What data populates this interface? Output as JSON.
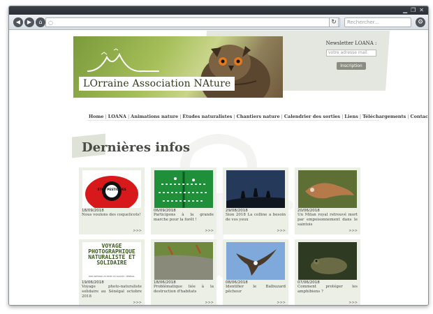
{
  "browser": {
    "search_placeholder": "Rechercher...",
    "nav_icons": [
      "back-icon",
      "forward-icon",
      "home-icon"
    ],
    "window_controls": [
      "minimize",
      "restore",
      "close"
    ]
  },
  "header": {
    "banner_title": "LOrraine Association NAture",
    "newsletter": {
      "title": "Newsletter LOANA :",
      "input_placeholder": "votre adresse mail",
      "button_label": "Inscription"
    }
  },
  "nav": {
    "items": [
      "Home",
      "LOANA",
      "Animations nature",
      "Études naturalistes",
      "Chantiers nature",
      "Calendrier des sorties",
      "Liens",
      "Téléchargements",
      "Contact"
    ]
  },
  "section": {
    "title": "Dernières infos"
  },
  "cards": [
    {
      "date": "18/09/2018",
      "text": "Nous voulons des coquelicots!",
      "more": ">>>"
    },
    {
      "date": "06/09/2018",
      "text": "Participons à la grande marche pour la forêt !",
      "more": ">>>"
    },
    {
      "date": "29/08/2018",
      "text": "Sion 2018 La colline a besoin de vos yeux",
      "more": ">>>"
    },
    {
      "date": "20/06/2018",
      "text": "Un Milan royal retrouvé mort par empoisonnement dans le saintois",
      "more": ">>>"
    },
    {
      "date": "19/06/2018",
      "text": "Voyage photo-naturaliste solidaire au Sénégal octobre 2018",
      "more": ">>>"
    },
    {
      "date": "18/06/2018",
      "text": "Problématique liée à la destruction d'habitats",
      "more": ">>>"
    },
    {
      "date": "08/06/2018",
      "text": "Identifier le Balbuzard pêcheur",
      "more": ">>>"
    },
    {
      "date": "07/06/2018",
      "text": "Comment protéger les amphibiens ?",
      "more": ">>>"
    }
  ],
  "card_images": {
    "card1_stamp_text": "STOP PESTICIDES",
    "card5_title": "VOYAGE PHOTOGRAPHIQUE NATURALISTE ET SOLIDAIRE",
    "card5_subtitle": "PARC NATIONAL DU DELTA DU SALOUM • SÉNÉGAL"
  },
  "colors": {
    "accent_green": "#7a9a3a",
    "card_bg": "#ecefe6",
    "header_bg": "#e4e6e0",
    "button_grey": "#8c8d82"
  }
}
